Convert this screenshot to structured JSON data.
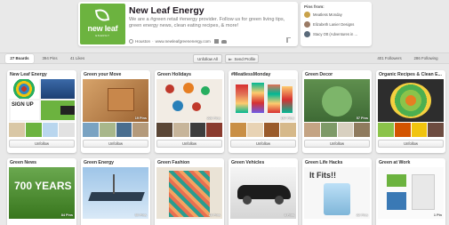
{
  "profile": {
    "logo_text": "new leaf",
    "logo_subtext": "ENERGY",
    "name": "New Leaf Energy",
    "bio": "We are a #green retail #energy provider. Follow us for green living tips, green energy news, clean eating recipes, & more!",
    "location": "Houston",
    "website": "www.newleafgreenenergy.com"
  },
  "pins_from": {
    "title": "Pins from:",
    "items": [
      {
        "label": "Meatless Monday",
        "color": "#c9a24a"
      },
      {
        "label": "Elizabeth Lanier Designs",
        "color": "#9a7a64"
      },
      {
        "label": "Stacy Ott (Adventures in ...",
        "color": "#5a6a7a"
      }
    ]
  },
  "tabs": {
    "boards": "27 Boards",
    "pins": "394 Pins",
    "likes": "41 Likes",
    "unfollow_all": "Unfollow All",
    "send_profile": "Send Profile",
    "followers": "401 Followers",
    "following": "286 Following"
  },
  "boards": [
    {
      "title": "New Leaf Energy",
      "count": "",
      "button": "Unfollow"
    },
    {
      "title": "Green your Move",
      "count": "19 Pins",
      "button": "Unfollow"
    },
    {
      "title": "Green Holidays",
      "count": "228 Pins",
      "button": "Unfollow"
    },
    {
      "title": "#MeatlessMonday",
      "count": "167 Pins",
      "button": "Unfollow"
    },
    {
      "title": "Green Decor",
      "count": "57 Pins",
      "button": "Unfollow"
    },
    {
      "title": "Organic Recipes & Clean E...",
      "count": "",
      "button": "Unfollow"
    },
    {
      "title": "Green News",
      "count": "84 Pins",
      "cover_text": "700 YEARS"
    },
    {
      "title": "Green Energy",
      "count": "50 Pins"
    },
    {
      "title": "Green Fashion",
      "count": "15 Pins"
    },
    {
      "title": "Green Vehicles",
      "count": "5 Pins"
    },
    {
      "title": "Green Life Hacks",
      "count": "22 Pins",
      "cover_text": "It Fits!!"
    },
    {
      "title": "Green at Work",
      "count": "1 Pin"
    }
  ]
}
